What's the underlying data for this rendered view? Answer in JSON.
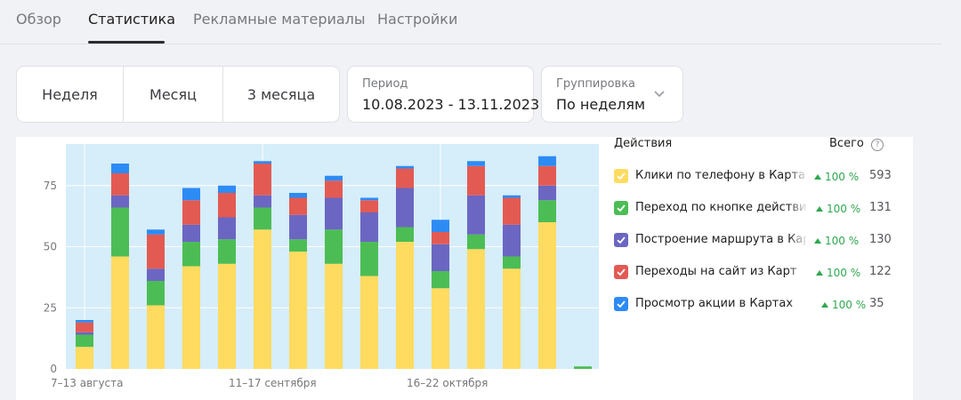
{
  "tabs": [
    {
      "label": "Обзор",
      "active": false
    },
    {
      "label": "Статистика",
      "active": true
    },
    {
      "label": "Рекламные материалы",
      "active": false
    },
    {
      "label": "Настройки",
      "active": false
    }
  ],
  "period_buttons": [
    "Неделя",
    "Месяц",
    "3 месяца"
  ],
  "period": {
    "label": "Период",
    "value": "10.08.2023 - 13.11.2023"
  },
  "grouping": {
    "label": "Группировка",
    "value": "По неделям"
  },
  "legend": {
    "actions_label": "Действия",
    "total_label": "Всего",
    "items": [
      {
        "name": "Клики по телефону в Картах",
        "change": "100 %",
        "total": "593",
        "color": "#ffdb60"
      },
      {
        "name": "Переход по кнопке действия",
        "change": "100 %",
        "total": "131",
        "color": "#4cbd55"
      },
      {
        "name": "Построение маршрута в Картах",
        "change": "100 %",
        "total": "130",
        "color": "#6b66c2"
      },
      {
        "name": "Переходы на сайт из Карт",
        "change": "100 %",
        "total": "122",
        "color": "#e35a53"
      },
      {
        "name": "Просмотр акции в Картах",
        "change": "100 %",
        "total": "35",
        "color": "#2d8bf5"
      }
    ]
  },
  "chart_data": {
    "type": "bar",
    "stacked": true,
    "categories": [
      "7–13 августа",
      "",
      "",
      "",
      "",
      "11–17 сентября",
      "",
      "",
      "",
      "",
      "16–22 октября",
      "",
      "",
      "",
      ""
    ],
    "series": [
      {
        "name": "Клики по телефону в Картах",
        "color": "#ffdb60",
        "values": [
          9,
          46,
          26,
          42,
          43,
          57,
          48,
          43,
          38,
          52,
          33,
          49,
          41,
          60,
          0
        ]
      },
      {
        "name": "Переход по кнопке действия",
        "color": "#4cbd55",
        "values": [
          5,
          20,
          10,
          10,
          10,
          9,
          5,
          14,
          14,
          6,
          7,
          6,
          5,
          9,
          1
        ]
      },
      {
        "name": "Построение маршрута в Картах",
        "color": "#6b66c2",
        "values": [
          1,
          5,
          5,
          7,
          9,
          5,
          10,
          13,
          12,
          16,
          11,
          16,
          13,
          6,
          0
        ]
      },
      {
        "name": "Переходы на сайт из Карт",
        "color": "#e35a53",
        "values": [
          4,
          9,
          14,
          10,
          10,
          13,
          7,
          7,
          5,
          8,
          5,
          12,
          11,
          8,
          0
        ]
      },
      {
        "name": "Просмотр акции в Картах",
        "color": "#2d8bf5",
        "values": [
          1,
          4,
          2,
          5,
          3,
          1,
          2,
          2,
          1,
          1,
          5,
          2,
          1,
          4,
          0
        ]
      }
    ],
    "y_ticks": [
      0,
      25,
      50,
      75
    ],
    "x_tick_labels": [
      "7–13 августа",
      "11–17 сентября",
      "16–22 октября"
    ],
    "ylim": [
      0,
      92
    ],
    "grid": true,
    "xlabel": "",
    "ylabel": ""
  }
}
